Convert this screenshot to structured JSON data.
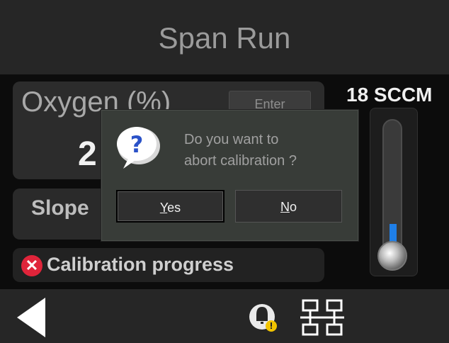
{
  "header": {
    "title": "Span Run"
  },
  "oxygen": {
    "label": "Oxygen (%)",
    "enter_label": "Enter",
    "value": "2"
  },
  "slope": {
    "label": "Slope"
  },
  "calibration": {
    "label": "Calibration progress",
    "status_icon": "error-x-icon",
    "status_color": "#e0243a"
  },
  "flow": {
    "label": "18 SCCM",
    "level_fraction": 0.08,
    "fill_color": "#1f7fe8"
  },
  "dialog": {
    "icon": "question-bubble-icon",
    "message_line1": "Do you want to",
    "message_line2": "abort calibration ?",
    "yes_mnemonic": "Y",
    "yes_rest": "es",
    "no_mnemonic": "N",
    "no_rest": "o"
  },
  "bottom_bar": {
    "back_icon": "back-arrow-icon",
    "alarm_icon": "bell-alert-icon",
    "network_icon": "network-icon"
  }
}
